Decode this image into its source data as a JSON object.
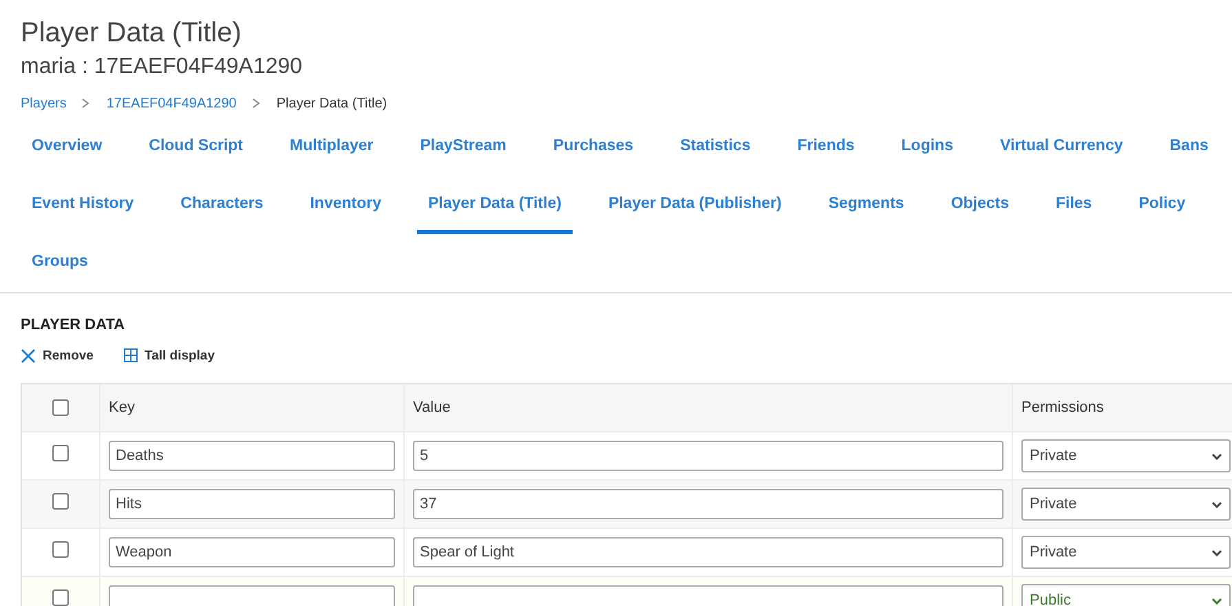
{
  "page": {
    "title": "Player Data (Title)",
    "subtitle": "maria : 17EAEF04F49A1290"
  },
  "breadcrumbs": [
    {
      "label": "Players",
      "current": false
    },
    {
      "label": "17EAEF04F49A1290",
      "current": false
    },
    {
      "label": "Player Data (Title)",
      "current": true
    }
  ],
  "tab_rows": [
    [
      {
        "label": "Overview",
        "selected": false
      },
      {
        "label": "Cloud Script",
        "selected": false
      },
      {
        "label": "Multiplayer",
        "selected": false
      },
      {
        "label": "PlayStream",
        "selected": false
      },
      {
        "label": "Purchases",
        "selected": false
      },
      {
        "label": "Statistics",
        "selected": false
      },
      {
        "label": "Friends",
        "selected": false
      },
      {
        "label": "Logins",
        "selected": false
      },
      {
        "label": "Virtual Currency",
        "selected": false
      },
      {
        "label": "Bans",
        "selected": false
      }
    ],
    [
      {
        "label": "Event History",
        "selected": false
      },
      {
        "label": "Characters",
        "selected": false
      },
      {
        "label": "Inventory",
        "selected": false
      },
      {
        "label": "Player Data (Title)",
        "selected": true
      },
      {
        "label": "Player Data (Publisher)",
        "selected": false
      },
      {
        "label": "Segments",
        "selected": false
      },
      {
        "label": "Objects",
        "selected": false
      },
      {
        "label": "Files",
        "selected": false
      },
      {
        "label": "Policy",
        "selected": false
      }
    ],
    [
      {
        "label": "Groups",
        "selected": false
      }
    ]
  ],
  "section": {
    "heading": "PLAYER DATA"
  },
  "toolbar": [
    {
      "kind": "remove",
      "label": "Remove"
    },
    {
      "kind": "grid",
      "label": "Tall display"
    }
  ],
  "table": {
    "select_all_checked": false,
    "columns": [
      "Key",
      "Value",
      "Permissions"
    ],
    "rows": [
      {
        "kind": "saved",
        "checked": false,
        "key": "Deaths",
        "value": "5",
        "permission": "Private"
      },
      {
        "kind": "saved",
        "checked": false,
        "key": "Hits",
        "value": "37",
        "permission": "Private"
      },
      {
        "kind": "saved",
        "checked": false,
        "key": "Weapon",
        "value": "Spear of Light",
        "permission": "Private"
      },
      {
        "kind": "new",
        "checked": false,
        "key": "",
        "value": "",
        "permission": "Public"
      }
    ]
  }
}
